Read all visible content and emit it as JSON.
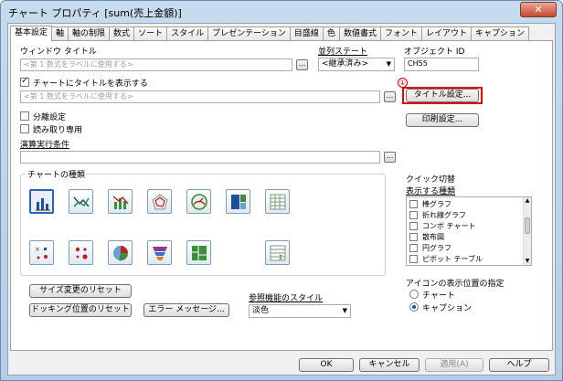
{
  "window": {
    "title": "チャート プロパティ [sum(売上金額)]",
    "close_glyph": "✕"
  },
  "tabs": [
    {
      "label": "基本設定"
    },
    {
      "label": "軸"
    },
    {
      "label": "軸の制限"
    },
    {
      "label": "数式"
    },
    {
      "label": "ソート"
    },
    {
      "label": "スタイル"
    },
    {
      "label": "プレゼンテーション"
    },
    {
      "label": "目盛線"
    },
    {
      "label": "色"
    },
    {
      "label": "数値書式"
    },
    {
      "label": "フォント"
    },
    {
      "label": "レイアウト"
    },
    {
      "label": "キャプション"
    }
  ],
  "general": {
    "window_title_label": "ウィンドウ タイトル",
    "window_title_placeholder": "<第 1 数式をラベルに使用する>",
    "ellipsis": "...",
    "show_title_label": "チャートにタイトルを表示する",
    "show_title_checked": true,
    "chart_title_placeholder": "<第 1 数式をラベルに使用する>",
    "parallel_state_label": "並列ステート",
    "parallel_state_value": "<継承済み>",
    "object_id_label": "オブジェクト ID",
    "object_id_value": "CH55",
    "marker_number": "①",
    "title_settings_button": "タイトル設定...",
    "print_settings_button": "印刷設定...",
    "detached_label": "分離設定",
    "detached_checked": false,
    "read_only_label": "読み取り専用",
    "read_only_checked": false,
    "calc_condition_label": "演算実行条件",
    "calc_condition_value": ""
  },
  "chart_types": {
    "label": "チャートの種類",
    "selected_index": 0,
    "icons": [
      {
        "name": "bar-chart-icon"
      },
      {
        "name": "line-chart-icon"
      },
      {
        "name": "combo-chart-icon"
      },
      {
        "name": "radar-chart-icon"
      },
      {
        "name": "gauge-chart-icon"
      },
      {
        "name": "block-chart-icon"
      },
      {
        "name": "pivot-table-icon"
      },
      {
        "name": "scatter-chart-icon"
      },
      {
        "name": "grid-chart-icon"
      },
      {
        "name": "pie-chart-icon"
      },
      {
        "name": "funnel-chart-icon"
      },
      {
        "name": "mekko-chart-icon"
      },
      {
        "name": "straight-table-icon"
      }
    ]
  },
  "quick_change": {
    "group_label": "クイック切替",
    "allowed_types_label": "表示する種類",
    "items": [
      {
        "label": "棒グラフ",
        "checked": false
      },
      {
        "label": "折れ線グラフ",
        "checked": false
      },
      {
        "label": "コンボ チャート",
        "checked": false
      },
      {
        "label": "散布図",
        "checked": false
      },
      {
        "label": "円グラフ",
        "checked": false
      },
      {
        "label": "ピボット テーブル",
        "checked": false
      }
    ],
    "scroll_up": "▲",
    "scroll_down": "▼"
  },
  "icon_position": {
    "label": "アイコンの表示位置の指定",
    "options": [
      {
        "label": "チャート",
        "checked": false
      },
      {
        "label": "キャプション",
        "checked": true
      }
    ]
  },
  "reset_buttons": {
    "size_reset": "サイズ変更のリセット",
    "docking_reset": "ドッキング位置のリセット",
    "error_messages": "エラー メッセージ..."
  },
  "reference_style": {
    "label": "参照機能のスタイル",
    "value": "淡色",
    "arrow": "▼"
  },
  "footer": {
    "ok": "OK",
    "cancel": "キャンセル",
    "apply": "適用(A)",
    "help": "ヘルプ"
  },
  "colors": {
    "highlight": "#e00000",
    "accent": "#2b63b8"
  }
}
